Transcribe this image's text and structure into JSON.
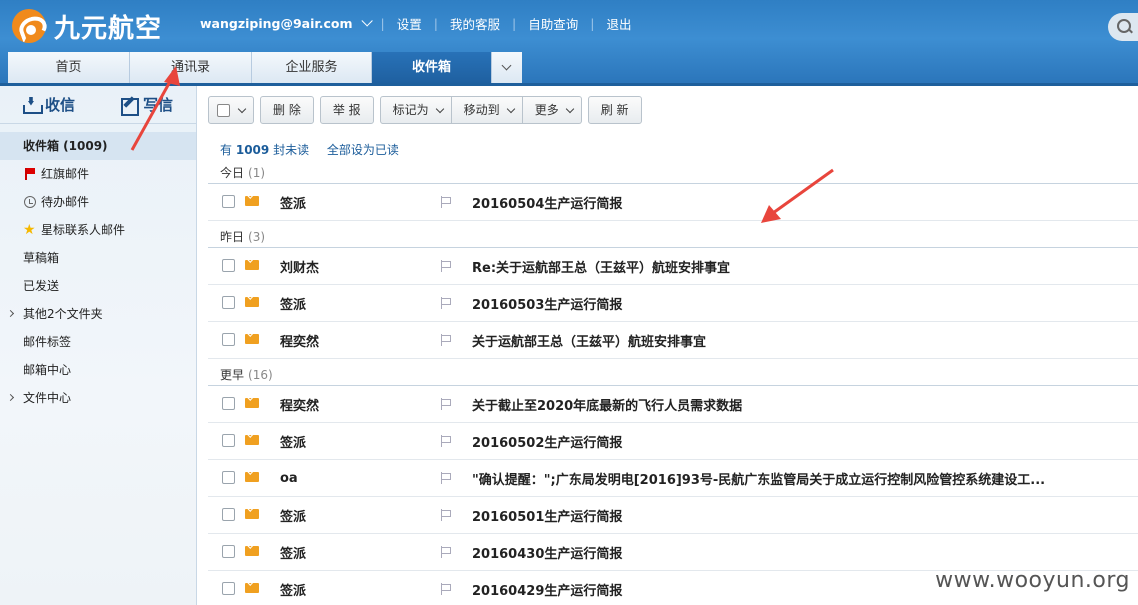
{
  "app": {
    "logo_text": "九元航空"
  },
  "topnav": {
    "user": "wangziping@9air.com",
    "links": [
      "设置",
      "我的客服",
      "自助查询",
      "退出"
    ]
  },
  "tabs": [
    {
      "label": "首页"
    },
    {
      "label": "通讯录"
    },
    {
      "label": "企业服务"
    },
    {
      "label": "收件箱",
      "active": true
    }
  ],
  "sidebar": {
    "receive_label": "收信",
    "write_label": "写信",
    "folders": [
      {
        "label": "收件箱 (1009)",
        "active": true
      },
      {
        "label": "红旗邮件",
        "icon": "red-flag-icon"
      },
      {
        "label": "待办邮件",
        "icon": "clock-icon"
      },
      {
        "label": "星标联系人邮件",
        "icon": "star-icon"
      },
      {
        "label": "草稿箱"
      },
      {
        "label": "已发送"
      },
      {
        "label": "其他2个文件夹",
        "expandable": true
      },
      {
        "label": "邮件标签"
      },
      {
        "label": "邮箱中心"
      },
      {
        "label": "文件中心",
        "expandable": true
      }
    ]
  },
  "toolbar": {
    "delete": "删 除",
    "report": "举 报",
    "mark_as": "标记为",
    "move_to": "移动到",
    "more": "更多",
    "refresh": "刷 新"
  },
  "unread": {
    "prefix": "有",
    "count": "1009",
    "suffix": "封未读",
    "mark_all": "全部设为已读"
  },
  "groups": [
    {
      "label": "今日",
      "count": "(1)"
    },
    {
      "label": "昨日",
      "count": "(3)"
    },
    {
      "label": "更早",
      "count": "(16)"
    }
  ],
  "mails": [
    {
      "sender": "签派",
      "subject": "20160504生产运行简报"
    },
    {
      "sender": "刘财杰",
      "subject": "Re:关于运航部王总（王兹平）航班安排事宜"
    },
    {
      "sender": "签派",
      "subject": "20160503生产运行简报"
    },
    {
      "sender": "程奕然",
      "subject": "关于运航部王总（王兹平）航班安排事宜"
    },
    {
      "sender": "程奕然",
      "subject": "关于截止至2020年底最新的飞行人员需求数据"
    },
    {
      "sender": "签派",
      "subject": "20160502生产运行简报"
    },
    {
      "sender": "oa",
      "subject": "\"确认提醒：\";广东局发明电[2016]93号-民航广东监管局关于成立运行控制风险管控系统建设工..."
    },
    {
      "sender": "签派",
      "subject": "20160501生产运行简报"
    },
    {
      "sender": "签派",
      "subject": "20160430生产运行简报"
    },
    {
      "sender": "签派",
      "subject": "20160429生产运行简报"
    }
  ],
  "watermark": "www.wooyun.org",
  "colors": {
    "header": "#2f7fc4",
    "active_tab": "#1f60a0",
    "envelope": "#f0a020",
    "arrow": "#e8453c"
  }
}
